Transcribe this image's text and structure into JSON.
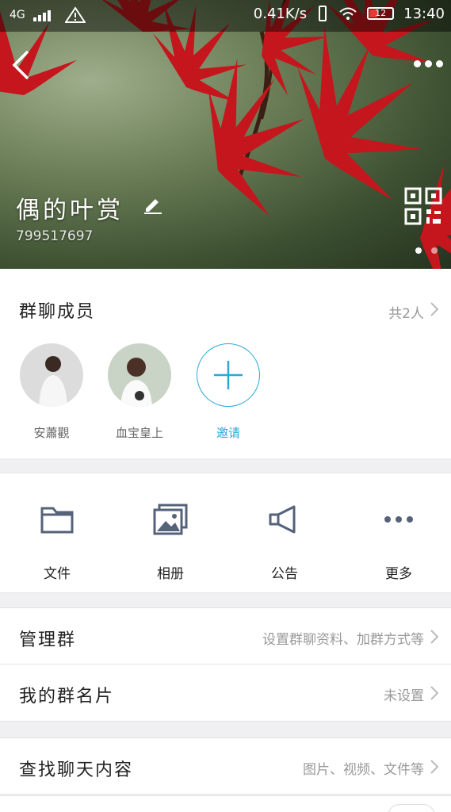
{
  "status_bar": {
    "network": "4G",
    "speed": "0.41K/s",
    "battery": "12",
    "time": "13:40"
  },
  "group": {
    "name": "偶的叶赏",
    "id": "799517697"
  },
  "members": {
    "title": "群聊成员",
    "count": "共2人",
    "list": [
      {
        "name": "安蕭觀"
      },
      {
        "name": "血宝皇上"
      }
    ],
    "invite_label": "邀请"
  },
  "actions": [
    {
      "label": "文件",
      "icon": "folder-icon"
    },
    {
      "label": "相册",
      "icon": "album-icon"
    },
    {
      "label": "公告",
      "icon": "megaphone-icon"
    },
    {
      "label": "更多",
      "icon": "more-dots-icon"
    }
  ],
  "rows": {
    "manage": {
      "title": "管理群",
      "value": "设置群聊资料、加群方式等"
    },
    "card": {
      "title": "我的群名片",
      "value": "未设置"
    },
    "search": {
      "title": "查找聊天内容",
      "value": "图片、视频、文件等"
    }
  },
  "colors": {
    "accent": "#29a8d8",
    "leaf": "#c4161c"
  }
}
